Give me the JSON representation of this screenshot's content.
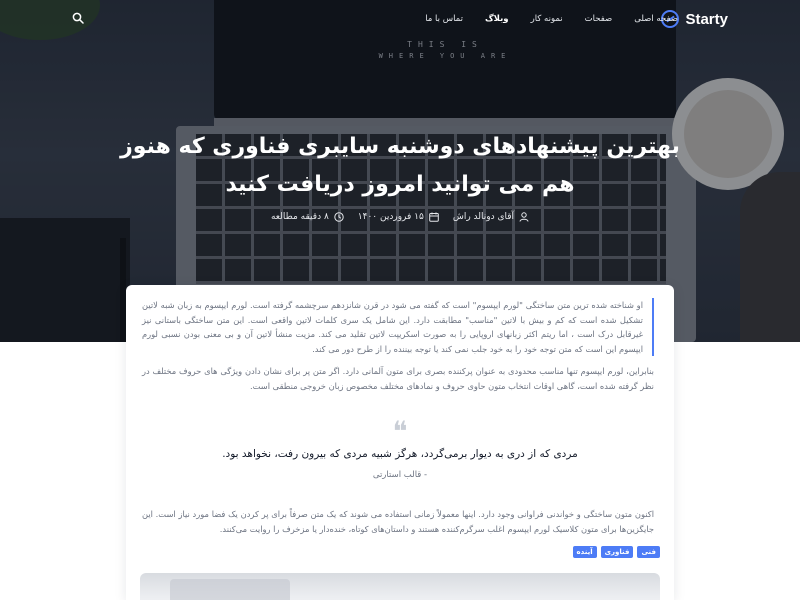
{
  "nav": {
    "brand": "Starty",
    "menu": [
      {
        "label": "صفحه اصلی",
        "active": false
      },
      {
        "label": "صفحات",
        "active": false
      },
      {
        "label": "نمونه کار",
        "active": false
      },
      {
        "label": "وبلاگ",
        "active": true
      },
      {
        "label": "تماس با ما",
        "active": false
      }
    ],
    "search_icon": "search-icon",
    "accent_color": "#4d7cf6"
  },
  "hero": {
    "screen_line1": "THIS IS",
    "screen_line2": "WHERE YOU ARE",
    "title": "بهترین پیشنهادهای دوشنبه سایبری فناوری که هنوز هم می توانید امروز دریافت کنید",
    "meta": {
      "author": "آقای دونالد راش",
      "date": "۱۵ فروردین ۱۴۰۰",
      "read_time": "۸ دقیقه مطالعه"
    }
  },
  "article": {
    "paragraph1": "او شناخته شده ترین متن ساختگی \"لورم ایپسوم\" است که گفته می شود در قرن شانزدهم سرچشمه گرفته است. لورم ایپسوم به زبان شبه لاتین تشکیل شده است که کم و بیش با لاتین \"مناسب\" مطابقت دارد. این شامل یک سری کلمات لاتین واقعی است. این متن ساختگی باستانی نیز غیرقابل درک است ، اما ریتم اکثر زبانهای اروپایی را به صورت اسکریپت لاتین تقلید می کند. مزیت منشأ لاتین آن و بی معنی بودن نسبی لورم ایپسوم این است که متن توجه خود را به خود جلب نمی کند یا توجه بیننده را از طرح دور می کند.",
    "paragraph2": "بنابراین، لورم ایپسوم تنها مناسب محدودی به عنوان پرکننده بصری برای متون آلمانی دارد. اگر متن پر برای نشان دادن ویژگی های حروف مختلف در نظر گرفته شده است، گاهی اوقات انتخاب متون حاوی حروف و نمادهای مختلف مخصوص زبان خروجی منطقی است.",
    "quote_mark": "❝",
    "quote": "مردی که از دری به دیوار برمی‌گردد، هرگز شبیه مردی که بیرون رفت، نخواهد بود.",
    "quote_author": "- قالب استارتی",
    "paragraph3": "اکنون متون ساختگی و خواندنی فراوانی وجود دارد. اینها معمولاً زمانی استفاده می شوند که یک متن صرفاً برای پر کردن یک فضا مورد نیاز است. این جایگزین‌ها برای متون کلاسیک لورم ایپسوم اغلب سرگرم‌کننده هستند و داستان‌های کوتاه، خنده‌دار یا مزخرف را روایت می‌کنند.",
    "tags": [
      "فنی",
      "فناوری",
      "آینده"
    ]
  }
}
